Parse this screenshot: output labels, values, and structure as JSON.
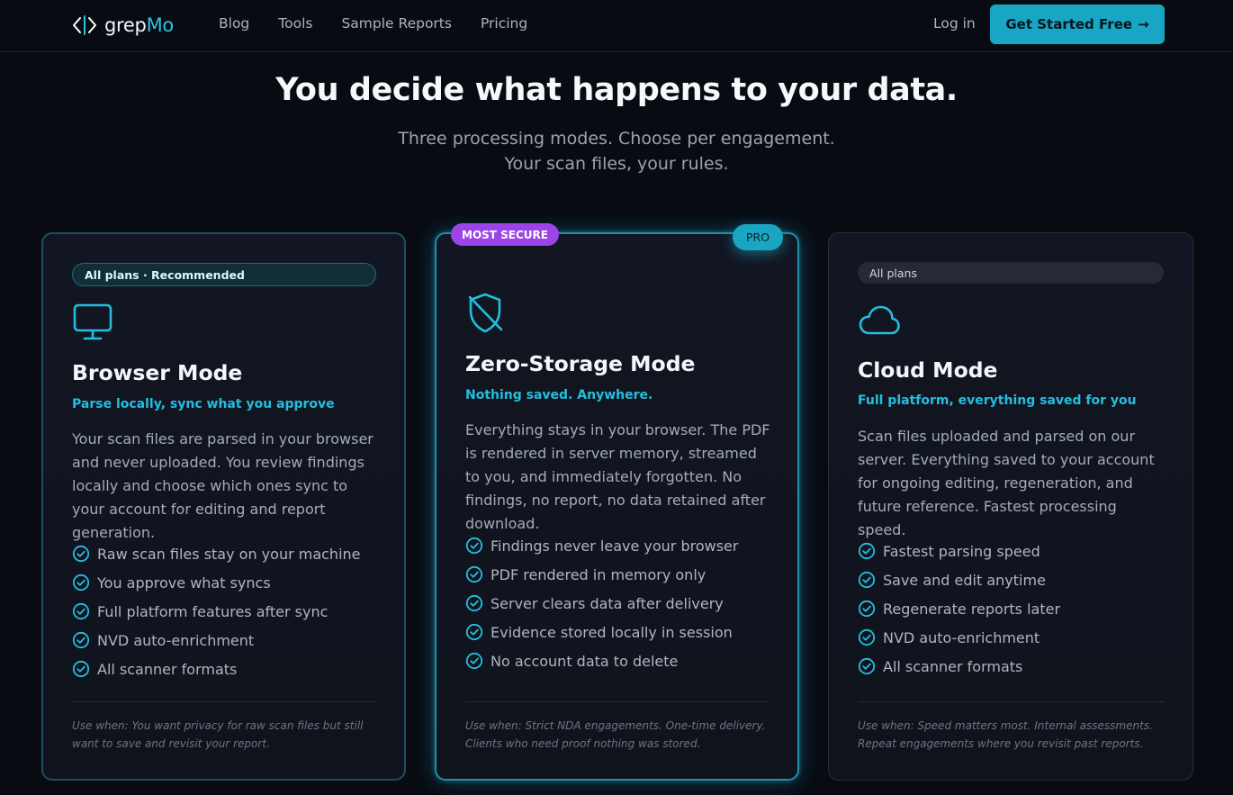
{
  "nav": {
    "logo_main": "grep",
    "logo_accent": "Mo",
    "links": [
      "Blog",
      "Tools",
      "Sample Reports",
      "Pricing"
    ],
    "login": "Log in",
    "cta": "Get Started Free",
    "cta_arrow": "→"
  },
  "hero": {
    "title": "You decide what happens to your data.",
    "subtitle_line1": "Three processing modes. Choose per engagement.",
    "subtitle_line2": "Your scan files, your rules."
  },
  "cards": [
    {
      "plan": "All plans · Recommended",
      "icon": "monitor-icon",
      "title": "Browser Mode",
      "tagline": "Parse locally, sync what you approve",
      "description": "Your scan files are parsed in your browser and never uploaded. You review findings locally and choose which ones sync to your account for editing and report generation.",
      "features": [
        "Raw scan files stay on your machine",
        "You approve what syncs",
        "Full platform features after sync",
        "NVD auto-enrichment",
        "All scanner formats"
      ],
      "use_when": "Use when: You want privacy for raw scan files but still want to save and revisit your report."
    },
    {
      "badge": "MOST SECURE",
      "pro": "PRO",
      "icon": "shield-off-icon",
      "title": "Zero-Storage Mode",
      "tagline": "Nothing saved. Anywhere.",
      "description": "Everything stays in your browser. The PDF is rendered in server memory, streamed to you, and immediately forgotten. No findings, no report, no data retained after download.",
      "features": [
        "Findings never leave your browser",
        "PDF rendered in memory only",
        "Server clears data after delivery",
        "Evidence stored locally in session",
        "No account data to delete"
      ],
      "use_when": "Use when: Strict NDA engagements. One-time delivery. Clients who need proof nothing was stored."
    },
    {
      "plan": "All plans",
      "icon": "cloud-icon",
      "title": "Cloud Mode",
      "tagline": "Full platform, everything saved for you",
      "description": "Scan files uploaded and parsed on our server. Everything saved to your account for ongoing editing, regeneration, and future reference. Fastest processing speed.",
      "features": [
        "Fastest parsing speed",
        "Save and edit anytime",
        "Regenerate reports later",
        "NVD auto-enrichment",
        "All scanner formats"
      ],
      "use_when": "Use when: Speed matters most. Internal assessments. Repeat engagements where you revisit past reports."
    }
  ],
  "colors": {
    "accent": "#22bfe0",
    "cta_bg": "#17a7c4",
    "badge_purple": "#9b45e8",
    "background": "#080b12"
  }
}
